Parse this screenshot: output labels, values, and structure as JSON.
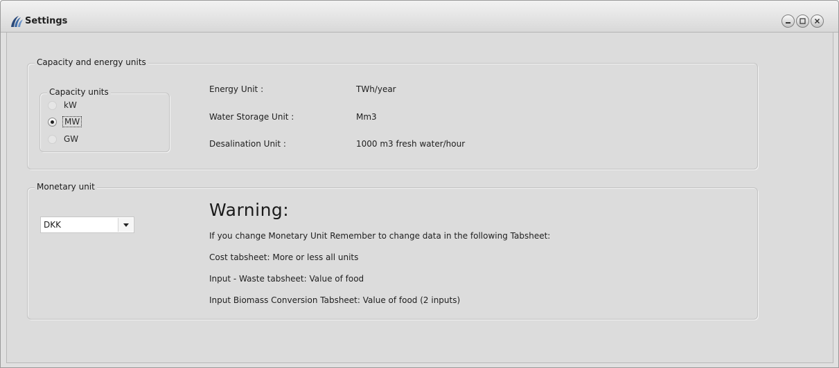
{
  "window": {
    "title": "Settings",
    "app_icon": "fan-logo-icon",
    "controls": {
      "minimize": "minimize-icon",
      "maximize": "maximize-icon",
      "close": "close-icon"
    }
  },
  "units_group": {
    "title": "Capacity and energy units",
    "capacity_units": {
      "title": "Capacity units",
      "options": [
        {
          "label": "kW",
          "selected": false
        },
        {
          "label": "MW",
          "selected": true
        },
        {
          "label": "GW",
          "selected": false
        }
      ]
    },
    "fields": [
      {
        "label": "Energy Unit :",
        "value": "TWh/year"
      },
      {
        "label": "Water Storage Unit :",
        "value": "Mm3"
      },
      {
        "label": "Desalination Unit :",
        "value": "1000 m3 fresh water/hour"
      }
    ]
  },
  "monetary_group": {
    "title": "Monetary unit",
    "currency": {
      "value": "DKK"
    },
    "warning": {
      "title": "Warning:",
      "lines": [
        "If you change Monetary Unit Remember to change data in the following Tabsheet:",
        "Cost tabsheet: More or less all units",
        "Input - Waste tabsheet: Value of food",
        "Input Biomass Conversion Tabsheet: Value of food  (2 inputs)"
      ]
    }
  }
}
